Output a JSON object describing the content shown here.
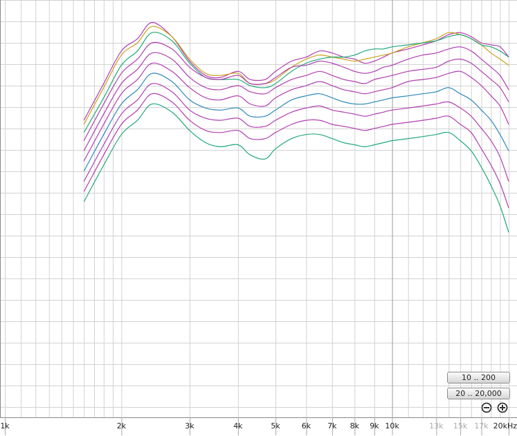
{
  "buttons": {
    "range_low": "10 .. 200",
    "range_full": "20 .. 20,000"
  },
  "icons": {
    "zoom_out": "zoom-out-icon",
    "zoom_in": "zoom-in-icon"
  },
  "colors": {
    "background": "#ffffff",
    "grid": "#d2d2d2",
    "grid_major": "#9a9a9a",
    "magenta": "#b03cb0",
    "teal": "#2b88b8",
    "green": "#1fa87a",
    "gold": "#c9a21a"
  },
  "chart_data": {
    "type": "line",
    "title": "",
    "xlabel": "",
    "ylabel": "",
    "x_scale": "log",
    "xlim": [
      1000,
      20000
    ],
    "grid": true,
    "x_ticks": [
      {
        "value": 1000,
        "label": "1k",
        "dim": false
      },
      {
        "value": 2000,
        "label": "2k",
        "dim": false
      },
      {
        "value": 3000,
        "label": "3k",
        "dim": false
      },
      {
        "value": 4000,
        "label": "4k",
        "dim": false
      },
      {
        "value": 5000,
        "label": "5k",
        "dim": false
      },
      {
        "value": 6000,
        "label": "6k",
        "dim": false
      },
      {
        "value": 7000,
        "label": "7k",
        "dim": false
      },
      {
        "value": 8000,
        "label": "8k",
        "dim": false
      },
      {
        "value": 9000,
        "label": "9k",
        "dim": false
      },
      {
        "value": 10000,
        "label": "10k",
        "dim": false
      },
      {
        "value": 13000,
        "label": "13k",
        "dim": true
      },
      {
        "value": 15000,
        "label": "15k",
        "dim": true
      },
      {
        "value": 17000,
        "label": "17k",
        "dim": true
      },
      {
        "value": 20000,
        "label": "20kHz",
        "dim": false
      }
    ],
    "x": [
      1600,
      1800,
      2000,
      2200,
      2400,
      2700,
      3000,
      3300,
      3600,
      4000,
      4300,
      4700,
      5000,
      5500,
      6000,
      6500,
      7000,
      7500,
      8000,
      8500,
      9000,
      9500,
      10000,
      11000,
      12000,
      13000,
      14000,
      15000,
      16000,
      17000,
      18000,
      19000,
      20000
    ],
    "series": [
      {
        "color": "#b03cb0",
        "values": [
          100.3,
          102.1,
          103.7,
          104.3,
          105.1,
          104.4,
          103.2,
          102.5,
          102.4,
          102.7,
          102.3,
          102.3,
          102.7,
          103.2,
          103.4,
          103.7,
          103.6,
          103.4,
          103.3,
          103.1,
          103.2,
          103.4,
          103.6,
          103.8,
          104.0,
          104.2,
          104.5,
          104.6,
          104.4,
          104.1,
          104.0,
          103.9,
          103.4
        ]
      },
      {
        "color": "#c9a21a",
        "values": [
          100.1,
          101.9,
          103.5,
          104.1,
          104.9,
          104.4,
          103.3,
          102.6,
          102.5,
          102.6,
          102.1,
          102.1,
          102.3,
          102.9,
          103.3,
          103.5,
          103.4,
          103.3,
          103.2,
          103.3,
          103.4,
          103.5,
          103.6,
          103.9,
          104.1,
          104.3,
          104.6,
          104.5,
          104.3,
          104.0,
          103.6,
          103.3,
          103.0
        ]
      },
      {
        "color": "#1fa87a",
        "values": [
          99.7,
          101.4,
          103.0,
          103.7,
          104.6,
          104.2,
          103.1,
          102.4,
          102.3,
          102.3,
          102.0,
          101.9,
          102.1,
          102.7,
          103.1,
          103.3,
          103.4,
          103.4,
          103.5,
          103.7,
          103.8,
          103.8,
          103.9,
          104.0,
          104.1,
          104.2,
          104.4,
          104.5,
          104.3,
          104.0,
          103.9,
          103.7,
          103.4
        ]
      },
      {
        "color": "#b03cb0",
        "values": [
          99.3,
          101.1,
          102.6,
          103.3,
          104.1,
          103.8,
          102.9,
          102.4,
          102.3,
          102.5,
          102.1,
          102.1,
          102.4,
          102.9,
          103.0,
          103.2,
          103.1,
          102.9,
          102.7,
          102.6,
          102.7,
          102.9,
          103.0,
          103.3,
          103.5,
          103.6,
          103.8,
          103.9,
          103.7,
          103.3,
          102.9,
          102.5,
          101.8
        ]
      },
      {
        "color": "#b03cb0",
        "values": [
          98.8,
          100.6,
          102.1,
          102.8,
          103.6,
          103.3,
          102.4,
          101.9,
          101.8,
          102.0,
          101.7,
          101.6,
          101.9,
          102.3,
          102.5,
          102.7,
          102.5,
          102.3,
          102.2,
          102.1,
          102.3,
          102.4,
          102.5,
          102.7,
          102.8,
          102.9,
          103.2,
          103.3,
          103.1,
          102.7,
          102.3,
          101.9,
          101.2
        ]
      },
      {
        "color": "#b03cb0",
        "values": [
          98.3,
          100.1,
          101.6,
          102.3,
          103.1,
          102.7,
          101.9,
          101.4,
          101.3,
          101.5,
          101.1,
          101.0,
          101.4,
          101.8,
          102.0,
          102.2,
          102.0,
          101.8,
          101.7,
          101.6,
          101.7,
          101.8,
          101.9,
          102.2,
          102.3,
          102.4,
          102.6,
          102.7,
          102.4,
          102.0,
          101.5,
          101.0,
          100.1
        ]
      },
      {
        "color": "#2b88b8",
        "values": [
          97.8,
          99.6,
          101.1,
          101.8,
          102.6,
          102.2,
          101.3,
          100.9,
          100.8,
          100.9,
          100.5,
          100.5,
          100.8,
          101.3,
          101.5,
          101.6,
          101.4,
          101.2,
          101.1,
          101.1,
          101.2,
          101.3,
          101.4,
          101.5,
          101.6,
          101.7,
          101.9,
          101.6,
          101.3,
          100.8,
          100.3,
          99.6,
          98.8
        ]
      },
      {
        "color": "#b03cb0",
        "values": [
          97.3,
          99.1,
          100.6,
          101.3,
          102.1,
          101.7,
          100.8,
          100.4,
          100.3,
          100.4,
          100.0,
          100.0,
          100.3,
          100.7,
          100.9,
          101.0,
          100.8,
          100.7,
          100.6,
          100.5,
          100.6,
          100.7,
          100.8,
          100.9,
          101.0,
          101.1,
          101.2,
          100.9,
          100.5,
          99.9,
          99.3,
          98.5,
          97.3
        ]
      },
      {
        "color": "#b03cb0",
        "values": [
          96.8,
          98.6,
          100.1,
          100.8,
          101.6,
          101.2,
          100.3,
          99.8,
          99.7,
          99.8,
          99.4,
          99.4,
          99.7,
          100.1,
          100.3,
          100.3,
          100.1,
          100.0,
          99.9,
          99.8,
          99.9,
          100.0,
          100.1,
          100.2,
          100.3,
          100.4,
          100.5,
          100.1,
          99.7,
          98.9,
          98.1,
          97.2,
          96.0
        ]
      },
      {
        "color": "#1fa87a",
        "values": [
          96.3,
          98.1,
          99.6,
          100.3,
          101.1,
          100.7,
          99.8,
          99.2,
          99.0,
          99.1,
          98.6,
          98.4,
          98.9,
          99.4,
          99.6,
          99.6,
          99.4,
          99.2,
          99.1,
          99.0,
          99.1,
          99.2,
          99.3,
          99.4,
          99.5,
          99.6,
          99.7,
          99.3,
          98.8,
          98.0,
          97.1,
          96.1,
          94.8
        ]
      }
    ]
  }
}
